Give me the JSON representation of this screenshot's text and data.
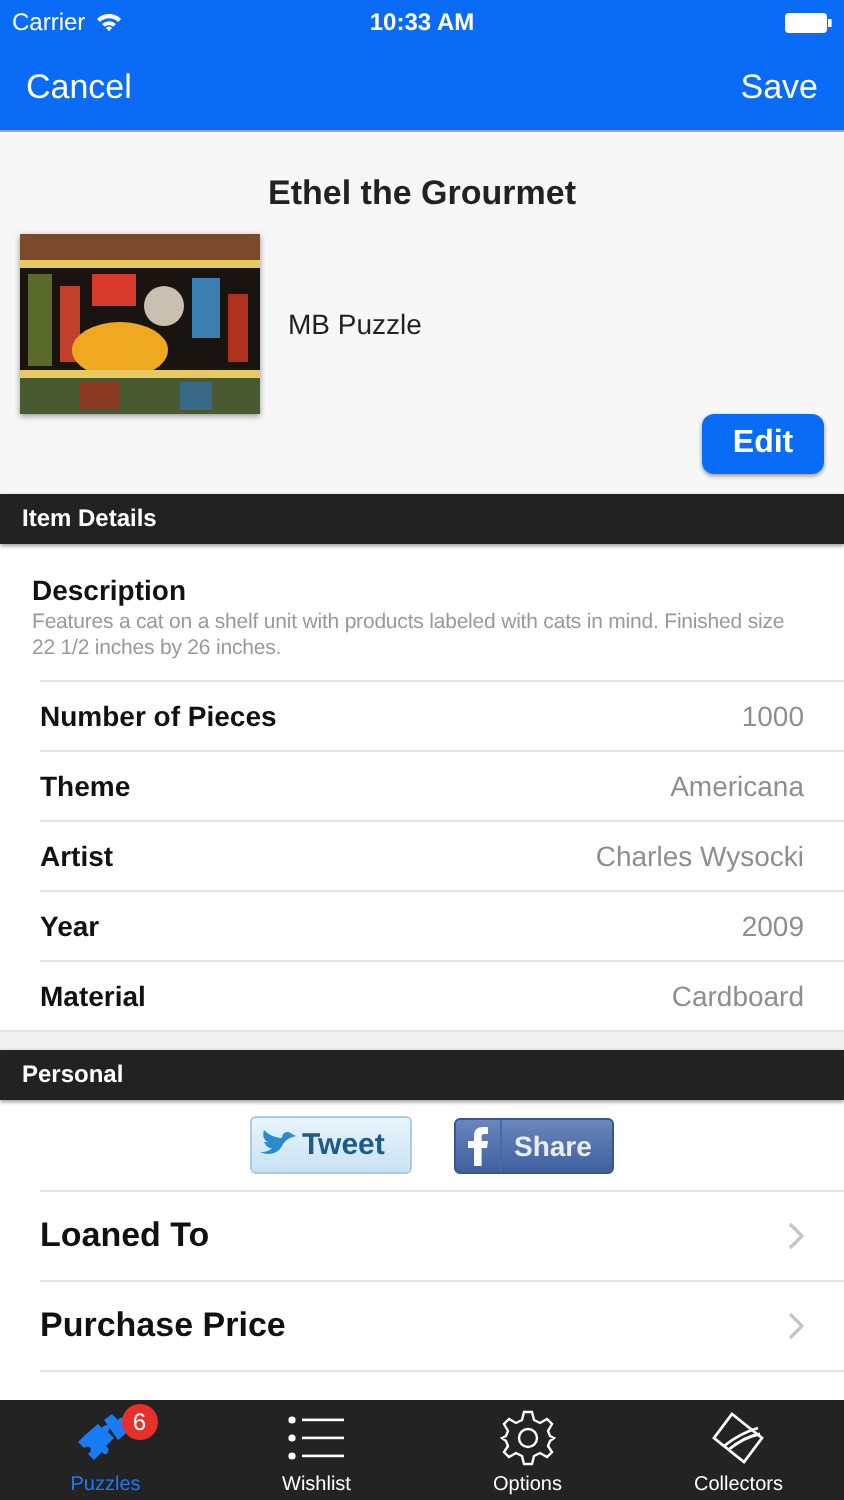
{
  "status_bar": {
    "carrier": "Carrier",
    "time": "10:33 AM"
  },
  "nav_bar": {
    "left": "Cancel",
    "right": "Save"
  },
  "item": {
    "title": "Ethel the Grourmet",
    "brand": "MB Puzzle",
    "edit": "Edit"
  },
  "item_details": {
    "header": "Item Details",
    "description_label": "Description",
    "description": "Features a cat on a shelf unit with products labeled with cats in mind. Finished size 22 1/2 inches by 26 inches.",
    "rows": [
      {
        "label": "Number of Pieces",
        "value": "1000"
      },
      {
        "label": "Theme",
        "value": "Americana"
      },
      {
        "label": "Artist",
        "value": "Charles Wysocki"
      },
      {
        "label": "Year",
        "value": "2009"
      },
      {
        "label": "Material",
        "value": "Cardboard"
      }
    ]
  },
  "personal": {
    "header": "Personal",
    "share_buttons": [
      {
        "kind": "twitter",
        "label": "Tweet"
      },
      {
        "kind": "facebook",
        "label": "Share"
      }
    ],
    "rows": [
      {
        "label": "Loaned To"
      },
      {
        "label": "Purchase Price"
      }
    ]
  },
  "tab_bar": [
    {
      "kind": "puzzles",
      "label": "Puzzles",
      "selected": true,
      "badge": "6"
    },
    {
      "kind": "wishlist",
      "label": "Wishlist",
      "selected": false
    },
    {
      "kind": "options",
      "label": "Options",
      "selected": false
    },
    {
      "kind": "collectors",
      "label": "Collectors",
      "selected": false
    }
  ]
}
